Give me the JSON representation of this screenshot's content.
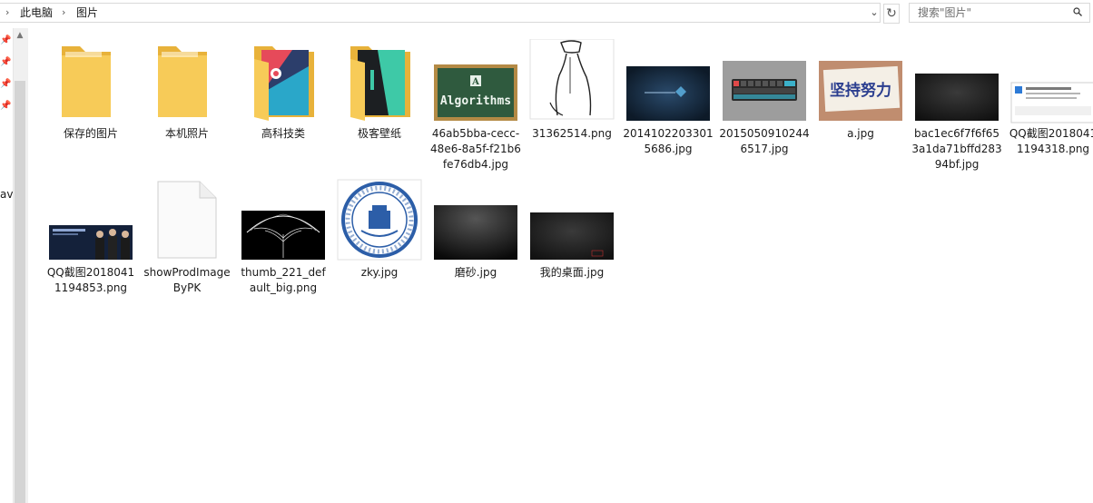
{
  "breadcrumb": {
    "items": [
      "此电脑",
      "图片"
    ]
  },
  "search": {
    "placeholder": "搜索\"图片\""
  },
  "nav": {
    "truncated_label": "av"
  },
  "files": [
    {
      "label": "保存的图片",
      "icon": "folder-icon"
    },
    {
      "label": "本机照片",
      "icon": "folder-icon"
    },
    {
      "label": "高科技类",
      "icon": "folder-icon"
    },
    {
      "label": "极客壁纸",
      "icon": "folder-icon"
    },
    {
      "label": "46ab5bba-cecc-48e6-8a5f-f21b6fe76db4.jpg",
      "icon": "image-thumbnail-icon"
    },
    {
      "label": "31362514.png",
      "icon": "image-thumbnail-icon"
    },
    {
      "label": "20141022033015686.jpg",
      "icon": "image-thumbnail-icon"
    },
    {
      "label": "20150509102446517.jpg",
      "icon": "image-thumbnail-icon"
    },
    {
      "label": "a.jpg",
      "icon": "image-thumbnail-icon"
    },
    {
      "label": "bac1ec6f7f6f653a1da71bffd28394bf.jpg",
      "icon": "image-thumbnail-icon"
    },
    {
      "label": "QQ截图20180411194318.png",
      "icon": "image-thumbnail-icon"
    },
    {
      "label": "QQ截图20180411194853.png",
      "icon": "image-thumbnail-icon"
    },
    {
      "label": "showProdImageByPK",
      "icon": "blank-file-icon"
    },
    {
      "label": "thumb_221_default_big.png",
      "icon": "image-thumbnail-icon"
    },
    {
      "label": "zky.jpg",
      "icon": "image-thumbnail-icon"
    },
    {
      "label": "磨砂.jpg",
      "icon": "image-thumbnail-icon"
    },
    {
      "label": "我的桌面.jpg",
      "icon": "image-thumbnail-icon"
    }
  ],
  "thumbnail_text": {
    "algorithms": "Algorithms",
    "motto": "坚持努力"
  },
  "colors": {
    "folder": "#f5c54a",
    "folder_dark": "#e0a829",
    "chalkboard": "#2f5a3e",
    "chalk_frame": "#b48a45",
    "selection_border": "#d9d9d9"
  }
}
